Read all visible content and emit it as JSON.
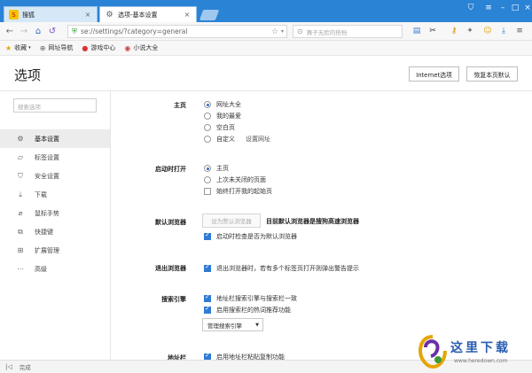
{
  "tabs": [
    {
      "label": "搜狐",
      "active": false
    },
    {
      "label": "选项-基本设置",
      "active": true
    }
  ],
  "address": {
    "url": "se://settings/?category=general"
  },
  "search": {
    "placeholder": "舞子无脸的搭档"
  },
  "bookmarks": [
    {
      "icon": "star-icon",
      "label": "收藏"
    },
    {
      "icon": "globe-icon",
      "label": "网址导航"
    },
    {
      "icon": "game-icon",
      "label": "游戏中心"
    },
    {
      "icon": "book-icon",
      "label": "小说大全"
    }
  ],
  "header": {
    "title": "选项",
    "internet_options": "Internet选项",
    "restore_defaults": "恢复本页默认"
  },
  "sidebar": {
    "search_placeholder": "搜索选项",
    "items": [
      {
        "label": "基本设置",
        "icon": "gear-icon",
        "active": true
      },
      {
        "label": "标签设置",
        "icon": "tab-icon",
        "active": false
      },
      {
        "label": "安全设置",
        "icon": "shield-icon",
        "active": false
      },
      {
        "label": "下载",
        "icon": "download-icon",
        "active": false
      },
      {
        "label": "鼠标手势",
        "icon": "mouse-icon",
        "active": false
      },
      {
        "label": "快捷键",
        "icon": "shortcut-icon",
        "active": false
      },
      {
        "label": "扩展管理",
        "icon": "grid-icon",
        "active": false
      },
      {
        "label": "高级",
        "icon": "dots-icon",
        "active": false
      }
    ]
  },
  "settings": {
    "homepage": {
      "label": "主页",
      "options": [
        "网址大全",
        "我的最爱",
        "空白页",
        "自定义"
      ],
      "selected": 0,
      "set_url_link": "设置网址"
    },
    "startup": {
      "label": "启动时打开",
      "options": [
        "主页",
        "上次未关闭的页面"
      ],
      "selected": 0,
      "checkbox": "始终打开我的起始页",
      "checked": false
    },
    "default_browser": {
      "label": "默认浏览器",
      "button": "设为默认浏览器",
      "status": "目前默认浏览器是搜狗高速浏览器",
      "checkbox": "启动时检查是否为默认浏览器",
      "checked": true
    },
    "exit": {
      "label": "退出浏览器",
      "checkbox": "退出浏览器时，若有多个标签页打开则弹出警告提示",
      "checked": true
    },
    "search_engine": {
      "label": "搜索引擎",
      "checkbox1": "地址栏搜索引擎与搜索栏一致",
      "checkbox2": "启用搜索栏的热词推荐功能",
      "dropdown": "管理搜索引擎"
    },
    "address_bar": {
      "label": "地址栏",
      "checkbox": "启用地址栏粘贴复制功能",
      "checked": true
    }
  },
  "status": {
    "text": "完成"
  },
  "watermark": {
    "text": "这里下载",
    "url": "www.heredown.com"
  },
  "colors": {
    "titlebar": "#2b83d6",
    "accent": "#2f7bd3"
  }
}
